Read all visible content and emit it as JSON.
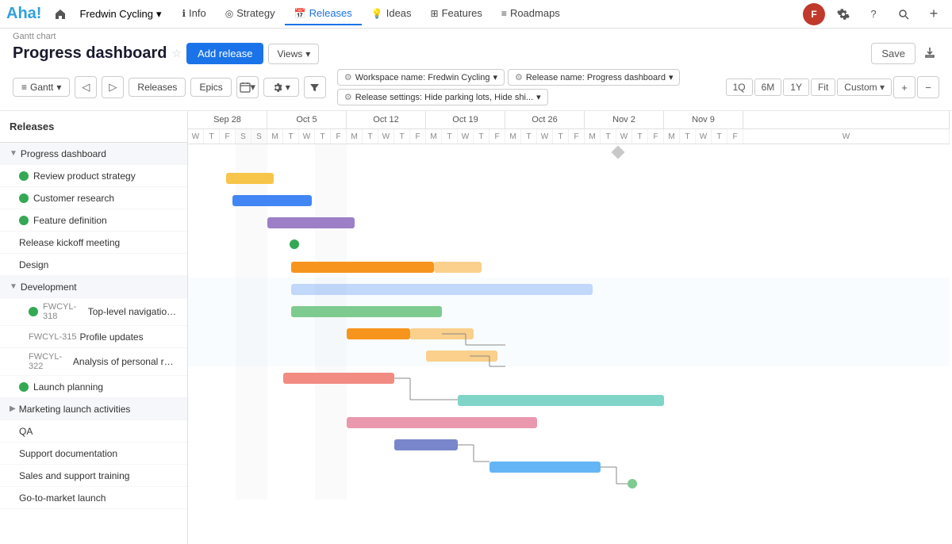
{
  "app": {
    "logo": "Aha!",
    "workspace": "Fredwin Cycling",
    "workspace_chevron": "▾"
  },
  "nav": {
    "home_icon": "⌂",
    "tabs": [
      {
        "id": "info",
        "label": "Info",
        "icon": "ℹ",
        "active": false
      },
      {
        "id": "strategy",
        "label": "Strategy",
        "icon": "◎",
        "active": false
      },
      {
        "id": "releases",
        "label": "Releases",
        "icon": "📅",
        "active": true
      },
      {
        "id": "ideas",
        "label": "Ideas",
        "icon": "💡",
        "active": false
      },
      {
        "id": "features",
        "label": "Features",
        "icon": "⊞",
        "active": false
      },
      {
        "id": "roadmaps",
        "label": "Roadmaps",
        "icon": "≡",
        "active": false
      }
    ],
    "icons_right": [
      "⚙",
      "?",
      "🔍",
      "+"
    ]
  },
  "page": {
    "gantt_label": "Gantt chart",
    "title": "Progress dashboard",
    "add_release": "Add release",
    "save": "Save",
    "views": "Views"
  },
  "toolbar": {
    "gantt": "Gantt",
    "releases": "Releases",
    "epics": "Epics",
    "filter": "▼",
    "workspace_filter": "Workspace name: Fredwin Cycling",
    "release_filter": "Release name: Progress dashboard",
    "settings_filter": "Release settings: Hide parking lots, Hide shi...",
    "zoom_1q": "1Q",
    "zoom_6m": "6M",
    "zoom_1y": "1Y",
    "zoom_fit": "Fit",
    "zoom_custom": "Custom ▾"
  },
  "sidebar": {
    "items": [
      {
        "id": "progress-dashboard",
        "label": "Progress dashboard",
        "type": "group",
        "indent": 0,
        "expanded": true
      },
      {
        "id": "review-product",
        "label": "Review product strategy",
        "type": "task",
        "indent": 1,
        "status": "green"
      },
      {
        "id": "customer-research",
        "label": "Customer research",
        "type": "task",
        "indent": 1,
        "status": "green"
      },
      {
        "id": "feature-definition",
        "label": "Feature definition",
        "type": "task",
        "indent": 1,
        "status": "green"
      },
      {
        "id": "release-kickoff",
        "label": "Release kickoff meeting",
        "type": "milestone",
        "indent": 1
      },
      {
        "id": "design",
        "label": "Design",
        "type": "task",
        "indent": 1
      },
      {
        "id": "development",
        "label": "Development",
        "type": "group",
        "indent": 0,
        "expanded": true
      },
      {
        "id": "fwcyl318",
        "label": "Top-level navigation re...",
        "code": "FWCYL-318",
        "type": "task",
        "indent": 2,
        "status": "green"
      },
      {
        "id": "fwcyl315",
        "label": "Profile updates",
        "code": "FWCYL-315",
        "type": "task",
        "indent": 2
      },
      {
        "id": "fwcyl322",
        "label": "Analysis of personal race g...",
        "code": "FWCYL-322",
        "type": "task",
        "indent": 2
      },
      {
        "id": "launch-planning",
        "label": "Launch planning",
        "type": "task",
        "indent": 1,
        "status": "green"
      },
      {
        "id": "marketing-launch",
        "label": "Marketing launch activities",
        "type": "group",
        "indent": 0,
        "expanded": false
      },
      {
        "id": "qa",
        "label": "QA",
        "type": "task",
        "indent": 1
      },
      {
        "id": "support-docs",
        "label": "Support documentation",
        "type": "task",
        "indent": 1
      },
      {
        "id": "sales-training",
        "label": "Sales and support training",
        "type": "task",
        "indent": 1
      },
      {
        "id": "go-to-market",
        "label": "Go-to-market launch",
        "type": "task",
        "indent": 1
      }
    ]
  },
  "dates": {
    "weeks": [
      {
        "label": "Sep 28",
        "cols": 5
      },
      {
        "label": "Oct 5",
        "cols": 5
      },
      {
        "label": "Oct 12",
        "cols": 5
      },
      {
        "label": "Oct 19",
        "cols": 5
      },
      {
        "label": "Oct 26",
        "cols": 5
      },
      {
        "label": "Nov 2",
        "cols": 5
      },
      {
        "label": "Nov 9",
        "cols": 5
      }
    ]
  },
  "colors": {
    "accent": "#1a73e8",
    "green": "#34a853",
    "orange": "#f7941d"
  }
}
